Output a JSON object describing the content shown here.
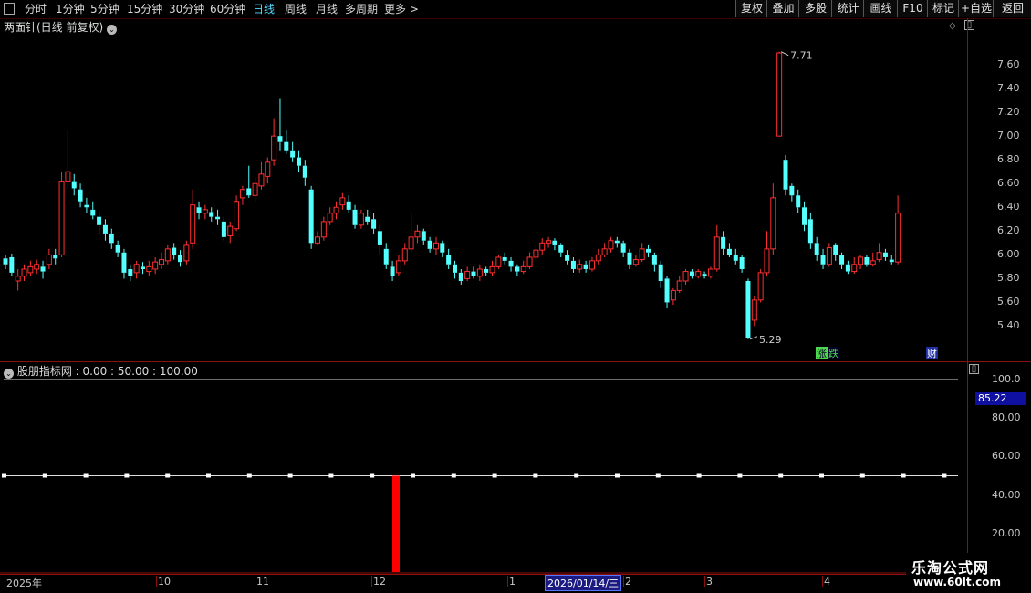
{
  "toolbar": {
    "periods": [
      "分时",
      "1分钟",
      "5分钟",
      "15分钟",
      "30分钟",
      "60分钟",
      "日线",
      "周线",
      "月线",
      "多周期",
      "更多 >"
    ],
    "active_period": "日线",
    "right_buttons": [
      "复权",
      "叠加",
      "多股",
      "统计",
      "画线",
      "F10",
      "标记",
      "+自选",
      "返回"
    ]
  },
  "main_chart": {
    "title": "两面针(日线 前复权)",
    "y_ticks": [
      "7.60",
      "7.40",
      "7.20",
      "7.00",
      "6.80",
      "6.60",
      "6.40",
      "6.20",
      "6.00",
      "5.80",
      "5.60",
      "5.40"
    ],
    "high_label": "7.71",
    "low_label": "5.29",
    "markers": [
      "涨",
      "跌",
      "财"
    ]
  },
  "indicator": {
    "title": "股朋指标网 : 0.00 : 50.00 : 100.00",
    "y_ticks": [
      "100.0",
      "80.00",
      "60.00",
      "40.00",
      "20.00"
    ],
    "current_value": "85.22"
  },
  "dates": {
    "labels": [
      "2025年",
      "10",
      "11",
      "12",
      "1",
      "2",
      "3",
      "4"
    ],
    "current": "2026/01/14/三"
  },
  "logo": {
    "line1": "乐淘公式网",
    "line2": "www.60lt.com"
  },
  "colors": {
    "up": "#ff3030",
    "down": "#54ffff",
    "accent": "#4fd8ff",
    "signal": "#ff0000"
  },
  "chart_data": {
    "type": "candlestick",
    "ylim": [
      5.25,
      7.8
    ],
    "candles": [
      [
        5.97,
        5.92,
        6.0,
        5.88
      ],
      [
        5.98,
        5.85,
        6.01,
        5.82
      ],
      [
        5.78,
        5.82,
        5.88,
        5.7
      ],
      [
        5.82,
        5.88,
        5.92,
        5.78
      ],
      [
        5.85,
        5.9,
        5.95,
        5.82
      ],
      [
        5.88,
        5.92,
        5.96,
        5.84
      ],
      [
        5.9,
        5.86,
        5.95,
        5.8
      ],
      [
        5.92,
        6.0,
        6.05,
        5.88
      ],
      [
        6.0,
        5.97,
        6.05,
        5.92
      ],
      [
        6.0,
        6.62,
        6.7,
        5.98
      ],
      [
        6.62,
        6.7,
        7.05,
        6.55
      ],
      [
        6.62,
        6.56,
        6.68,
        6.5
      ],
      [
        6.55,
        6.45,
        6.6,
        6.4
      ],
      [
        6.42,
        6.4,
        6.48,
        6.35
      ],
      [
        6.38,
        6.33,
        6.45,
        6.3
      ],
      [
        6.32,
        6.25,
        6.36,
        6.18
      ],
      [
        6.25,
        6.18,
        6.3,
        6.12
      ],
      [
        6.18,
        6.1,
        6.22,
        6.05
      ],
      [
        6.08,
        6.02,
        6.12,
        5.98
      ],
      [
        6.02,
        5.85,
        6.05,
        5.8
      ],
      [
        5.88,
        5.82,
        5.92,
        5.78
      ],
      [
        5.85,
        5.92,
        5.95,
        5.8
      ],
      [
        5.9,
        5.88,
        5.94,
        5.84
      ],
      [
        5.86,
        5.9,
        5.95,
        5.82
      ],
      [
        5.88,
        5.94,
        5.98,
        5.84
      ],
      [
        5.92,
        5.96,
        6.02,
        5.88
      ],
      [
        5.95,
        6.05,
        6.08,
        5.92
      ],
      [
        6.06,
        6.0,
        6.1,
        5.96
      ],
      [
        6.0,
        5.94,
        6.04,
        5.9
      ],
      [
        5.95,
        6.08,
        6.12,
        5.92
      ],
      [
        6.1,
        6.42,
        6.55,
        6.05
      ],
      [
        6.4,
        6.35,
        6.45,
        6.3
      ],
      [
        6.35,
        6.38,
        6.42,
        6.3
      ],
      [
        6.36,
        6.32,
        6.4,
        6.28
      ],
      [
        6.32,
        6.3,
        6.38,
        6.25
      ],
      [
        6.28,
        6.15,
        6.32,
        6.12
      ],
      [
        6.16,
        6.24,
        6.28,
        6.1
      ],
      [
        6.22,
        6.45,
        6.5,
        6.2
      ],
      [
        6.48,
        6.55,
        6.58,
        6.42
      ],
      [
        6.56,
        6.5,
        6.75,
        6.48
      ],
      [
        6.5,
        6.6,
        6.65,
        6.45
      ],
      [
        6.58,
        6.68,
        6.78,
        6.55
      ],
      [
        6.66,
        6.78,
        6.82,
        6.6
      ],
      [
        6.8,
        7.0,
        7.15,
        6.75
      ],
      [
        7.0,
        6.95,
        7.32,
        6.88
      ],
      [
        6.95,
        6.88,
        7.05,
        6.85
      ],
      [
        6.88,
        6.82,
        6.95,
        6.78
      ],
      [
        6.82,
        6.75,
        6.88,
        6.7
      ],
      [
        6.75,
        6.65,
        6.8,
        6.58
      ],
      [
        6.55,
        6.1,
        6.58,
        6.05
      ],
      [
        6.1,
        6.15,
        6.2,
        6.08
      ],
      [
        6.15,
        6.28,
        6.32,
        6.12
      ],
      [
        6.28,
        6.35,
        6.4,
        6.25
      ],
      [
        6.35,
        6.4,
        6.45,
        6.3
      ],
      [
        6.42,
        6.48,
        6.52,
        6.38
      ],
      [
        6.45,
        6.38,
        6.5,
        6.35
      ],
      [
        6.38,
        6.25,
        6.42,
        6.22
      ],
      [
        6.25,
        6.35,
        6.38,
        6.22
      ],
      [
        6.32,
        6.28,
        6.38,
        6.25
      ],
      [
        6.3,
        6.22,
        6.35,
        6.18
      ],
      [
        6.2,
        6.08,
        6.25,
        6.0
      ],
      [
        6.05,
        5.92,
        6.1,
        5.88
      ],
      [
        5.9,
        5.82,
        5.95,
        5.78
      ],
      [
        5.85,
        5.95,
        6.0,
        5.82
      ],
      [
        5.95,
        6.05,
        6.1,
        5.92
      ],
      [
        6.05,
        6.15,
        6.35,
        6.02
      ],
      [
        6.15,
        6.2,
        6.25,
        6.1
      ],
      [
        6.2,
        6.12,
        6.22,
        6.08
      ],
      [
        6.12,
        6.05,
        6.15,
        6.02
      ],
      [
        6.05,
        6.1,
        6.15,
        6.0
      ],
      [
        6.1,
        6.02,
        6.12,
        5.98
      ],
      [
        6.0,
        5.92,
        6.05,
        5.88
      ],
      [
        5.92,
        5.85,
        5.95,
        5.8
      ],
      [
        5.85,
        5.78,
        5.88,
        5.75
      ],
      [
        5.8,
        5.86,
        5.9,
        5.78
      ],
      [
        5.86,
        5.82,
        5.9,
        5.8
      ],
      [
        5.82,
        5.88,
        5.92,
        5.78
      ],
      [
        5.88,
        5.85,
        5.9,
        5.82
      ],
      [
        5.85,
        5.9,
        5.95,
        5.82
      ],
      [
        5.9,
        5.98,
        6.0,
        5.88
      ],
      [
        5.98,
        5.95,
        6.02,
        5.92
      ],
      [
        5.95,
        5.9,
        5.98,
        5.86
      ],
      [
        5.9,
        5.86,
        5.92,
        5.82
      ],
      [
        5.86,
        5.9,
        5.95,
        5.84
      ],
      [
        5.9,
        5.98,
        6.02,
        5.88
      ],
      [
        5.98,
        6.04,
        6.08,
        5.95
      ],
      [
        6.04,
        6.1,
        6.14,
        6.0
      ],
      [
        6.1,
        6.12,
        6.15,
        6.06
      ],
      [
        6.12,
        6.08,
        6.14,
        6.04
      ],
      [
        6.08,
        6.02,
        6.1,
        5.98
      ],
      [
        6.0,
        5.95,
        6.04,
        5.92
      ],
      [
        5.95,
        5.88,
        5.98,
        5.85
      ],
      [
        5.88,
        5.92,
        5.96,
        5.85
      ],
      [
        5.92,
        5.88,
        5.95,
        5.85
      ],
      [
        5.88,
        5.95,
        5.98,
        5.86
      ],
      [
        5.95,
        6.0,
        6.05,
        5.92
      ],
      [
        6.0,
        6.05,
        6.1,
        5.98
      ],
      [
        6.05,
        6.12,
        6.15,
        6.02
      ],
      [
        6.12,
        6.1,
        6.15,
        6.06
      ],
      [
        6.1,
        6.02,
        6.12,
        5.98
      ],
      [
        6.02,
        5.92,
        6.05,
        5.88
      ],
      [
        5.92,
        5.96,
        6.0,
        5.9
      ],
      [
        5.96,
        6.05,
        6.1,
        5.94
      ],
      [
        6.05,
        6.02,
        6.08,
        5.98
      ],
      [
        6.0,
        5.92,
        6.02,
        5.86
      ],
      [
        5.92,
        5.78,
        5.95,
        5.72
      ],
      [
        5.8,
        5.6,
        5.82,
        5.55
      ],
      [
        5.62,
        5.7,
        5.72,
        5.58
      ],
      [
        5.7,
        5.78,
        5.82,
        5.68
      ],
      [
        5.78,
        5.86,
        5.88,
        5.75
      ],
      [
        5.86,
        5.82,
        5.88,
        5.8
      ],
      [
        5.82,
        5.86,
        5.88,
        5.8
      ],
      [
        5.84,
        5.82,
        5.86,
        5.8
      ],
      [
        5.82,
        5.88,
        5.9,
        5.8
      ],
      [
        5.88,
        6.15,
        6.25,
        5.86
      ],
      [
        6.15,
        6.05,
        6.2,
        6.0
      ],
      [
        6.05,
        6.0,
        6.1,
        5.98
      ],
      [
        6.0,
        5.95,
        6.05,
        5.92
      ],
      [
        5.98,
        5.88,
        6.0,
        5.85
      ],
      [
        5.78,
        5.3,
        5.8,
        5.29
      ],
      [
        5.45,
        5.62,
        5.65,
        5.4
      ],
      [
        5.62,
        5.85,
        5.88,
        5.6
      ],
      [
        5.85,
        6.05,
        6.2,
        5.82
      ],
      [
        6.05,
        6.48,
        6.6,
        6.0
      ],
      [
        7.0,
        7.7,
        7.71,
        7.0
      ],
      [
        6.8,
        6.55,
        6.84,
        6.5
      ],
      [
        6.58,
        6.5,
        6.6,
        6.45
      ],
      [
        6.5,
        6.4,
        6.55,
        6.35
      ],
      [
        6.4,
        6.25,
        6.45,
        6.2
      ],
      [
        6.3,
        6.1,
        6.35,
        6.05
      ],
      [
        6.1,
        6.0,
        6.15,
        5.95
      ],
      [
        6.0,
        5.92,
        6.05,
        5.88
      ],
      [
        5.92,
        6.06,
        6.1,
        5.9
      ],
      [
        6.08,
        6.0,
        6.1,
        5.95
      ],
      [
        6.0,
        5.92,
        6.02,
        5.88
      ],
      [
        5.92,
        5.86,
        5.95,
        5.84
      ],
      [
        5.86,
        5.92,
        5.98,
        5.84
      ],
      [
        5.92,
        5.98,
        6.0,
        5.88
      ],
      [
        5.98,
        5.92,
        6.0,
        5.9
      ],
      [
        5.92,
        5.95,
        6.02,
        5.9
      ],
      [
        5.96,
        6.02,
        6.1,
        5.94
      ],
      [
        6.02,
        5.98,
        6.05,
        5.95
      ],
      [
        5.96,
        5.94,
        6.0,
        5.92
      ],
      [
        5.94,
        6.35,
        6.5,
        5.92
      ]
    ],
    "indicator": {
      "level_line": 100,
      "dotted_line": 50,
      "signal_bar": {
        "top": 50,
        "bottom": 0
      }
    }
  }
}
